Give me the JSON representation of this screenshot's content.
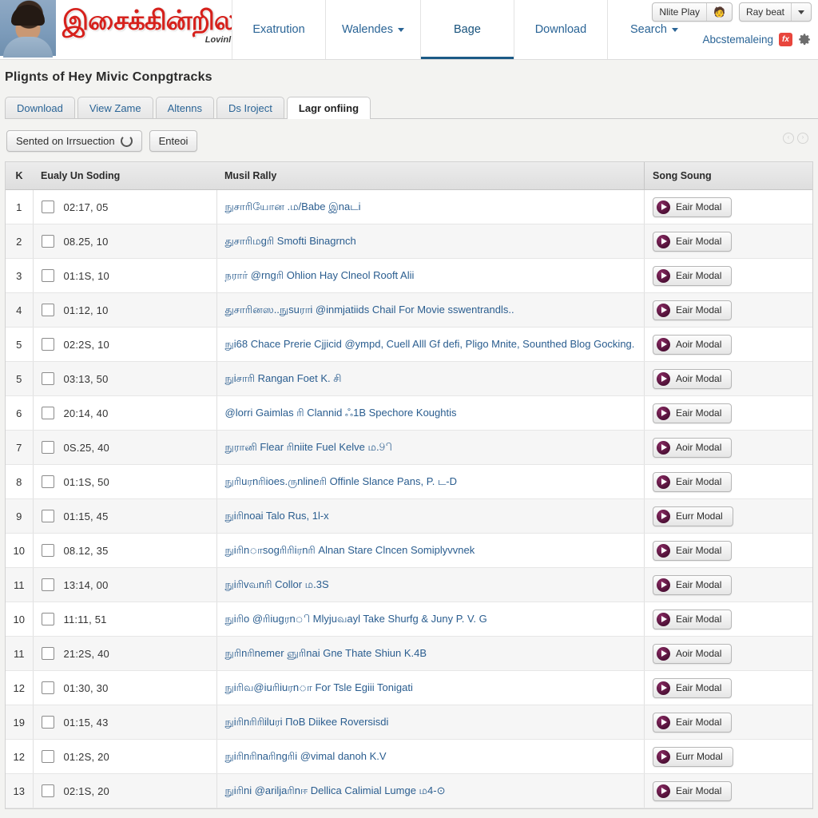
{
  "header": {
    "brand_title": "இசைக்கின்றில",
    "brand_sub": "Lovinl",
    "nav": [
      {
        "label": "Exatrution",
        "caret": false,
        "active": false
      },
      {
        "label": "Walendes",
        "caret": true,
        "active": false
      },
      {
        "label": "Bage",
        "caret": false,
        "active": true
      },
      {
        "label": "Download",
        "caret": false,
        "active": false
      },
      {
        "label": "Search",
        "caret": true,
        "active": false
      }
    ],
    "top_buttons": [
      {
        "label": "Nlite Play",
        "emoji": "🧑",
        "caret": false
      },
      {
        "label": "Ray beat",
        "emoji": "",
        "caret": true
      }
    ],
    "account_label": "Abcstemaleing",
    "badge_label": "fx",
    "gear_icon": "gear-icon"
  },
  "page": {
    "title": "Plignts of Hey Mivic Conpgtracks",
    "tabs": [
      {
        "label": "Download",
        "active": false
      },
      {
        "label": "View Zame",
        "active": false
      },
      {
        "label": "Altenns",
        "active": false
      },
      {
        "label": "Ds Iroject",
        "active": false
      },
      {
        "label": "Lagr onfiing",
        "active": true
      }
    ],
    "toolbar": {
      "sort_button": "Sented on Irrsuection",
      "enter_button": "Enteoi"
    },
    "mini_icons": [
      "prev-circle-icon",
      "next-circle-icon"
    ]
  },
  "table": {
    "columns": {
      "num": "K",
      "time": "Eualy Un Soding",
      "title": "Musil Rally",
      "action": "Song Soung"
    },
    "play_label_a": "Eair Modal",
    "play_label_b": "Aoir Modal",
    "play_label_c": "Eurr Modal",
    "rows": [
      {
        "num": "1",
        "time": "02:17, 05",
        "title": "நுசாரியோன .ம/Babe இnaடi",
        "action": "Eair Modal"
      },
      {
        "num": "2",
        "time": "08.25, 10",
        "title": "துசாரிமgரி Smofti Binagrnch",
        "action": "Eair Modal"
      },
      {
        "num": "3",
        "time": "01:1S, 10",
        "title": "நரார் @rngரி Ohlion Hay Clneol Rooft Alii",
        "action": "Eair Modal"
      },
      {
        "num": "4",
        "time": "01:12, 10",
        "title": "துசாரினஸ..நுsuராi @inmjatiids Chail For Movie sswentrandls..",
        "action": "Eair Modal"
      },
      {
        "num": "5",
        "time": "02:2S, 10",
        "title": "நுi68 Chace Prerie Cjjicid @ympd, Cuell Alll Gf defi, Pligo Mnite, Sounthed Blog Gocking.",
        "action": "Aoir Modal"
      },
      {
        "num": "5",
        "time": "03:13, 50",
        "title": "நுiசாரி Rangan Foet K. சி",
        "action": "Aoir Modal"
      },
      {
        "num": "6",
        "time": "20:14, 40",
        "title": "@lorri Gaimlas ரி Clannid ஃ1B Spechore Koughtis",
        "action": "Eair Modal"
      },
      {
        "num": "7",
        "time": "0S.25, 40",
        "title": "நுரானி Flear ரிniite Fuel Kelve ம.9ி",
        "action": "Aoir Modal"
      },
      {
        "num": "8",
        "time": "01:1S, 50",
        "title": "நுரிuரnரிioes.ருnlineரி Offinle Slance Pans, P. ட-D",
        "action": "Eair Modal"
      },
      {
        "num": "9",
        "time": "01:15, 45",
        "title": "நுiரிnoai Talo Rus, 1l-x",
        "action": "Eurr Modal"
      },
      {
        "num": "10",
        "time": "08.12, 35",
        "title": "நுiரிnாsogரிரிiரnரி Alnan Stare Clncen Somiplyvvnek",
        "action": "Eair Modal"
      },
      {
        "num": "11",
        "time": "13:14, 00",
        "title": "நுiரிvவnரி Collor ம.3S",
        "action": "Eair Modal"
      },
      {
        "num": "10",
        "time": "11:11, 51",
        "title": "நுiரிo @ரிiugரnி Mlyjuவayl Take Shurfg & Juny P. V. G",
        "action": "Eair Modal"
      },
      {
        "num": "11",
        "time": "21:2S, 40",
        "title": "நுரிnரிnemer ஞுரிnai Gne Thate Shiun K.4B",
        "action": "Aoir Modal"
      },
      {
        "num": "12",
        "time": "01:30, 30",
        "title": "நுiரிவ@iuரிiuரnா For Tsle Egiii Tonigati",
        "action": "Eair Modal"
      },
      {
        "num": "19",
        "time": "01:15, 43",
        "title": "நுiரிnரிரிiluரi ПoB Diikee Roversisdi",
        "action": "Eair Modal"
      },
      {
        "num": "12",
        "time": "01:2S, 20",
        "title": "நுiரிnரிnaரிngரிi @vimal danoh K.V",
        "action": "Eurr Modal"
      },
      {
        "num": "13",
        "time": "02:1S, 20",
        "title": "நுiரிni @ariljaரிnஈ Dellica Calimial Lumge ம4-⊙",
        "action": "Eair Modal"
      }
    ]
  },
  "colors": {
    "link": "#2a5d8f",
    "nav_link": "#2a6496",
    "brand_red": "#d6211c",
    "badge_red": "#e8453c",
    "play_purple": "#4e1036",
    "active_tab_underline": "#1b5a86"
  }
}
